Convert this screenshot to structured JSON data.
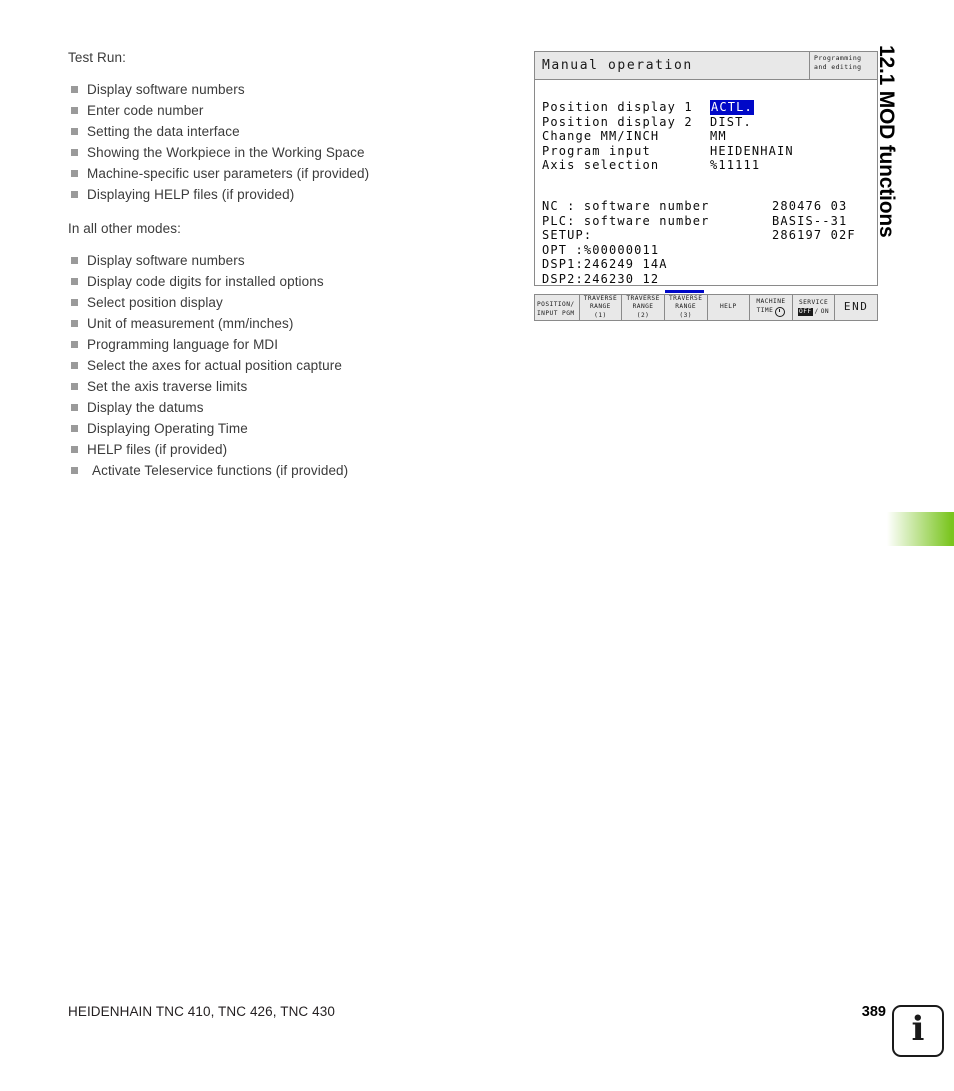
{
  "left_column": {
    "heading_1": "Test Run:",
    "list_1": [
      "Display software numbers",
      "Enter code number",
      "Setting the data interface",
      "Showing the Workpiece in the Working Space",
      "Machine-specific user parameters (if provided)",
      "Displaying HELP files (if provided)"
    ],
    "heading_2": "In all other modes:",
    "list_2": [
      "Display software numbers",
      "Display code digits for installed options",
      "Select position display",
      "Unit of measurement (mm/inches)",
      "Programming language for MDI",
      "Select the axes for actual position capture",
      "Set the axis traverse limits",
      "Display the datums",
      "Displaying Operating Time",
      "HELP files (if provided)",
      "Activate Teleservice functions (if provided)"
    ]
  },
  "tnc_screen": {
    "mode_title": "Manual operation",
    "submode_line1": "Programming",
    "submode_line2": "and editing",
    "mod_rows": [
      {
        "label": "Position display 1",
        "value": "ACTL.",
        "highlighted": true
      },
      {
        "label": "Position display 2",
        "value": "DIST.",
        "highlighted": false
      },
      {
        "label": "Change MM/INCH",
        "value": "MM",
        "highlighted": false
      },
      {
        "label": "Program input",
        "value": "HEIDENHAIN",
        "highlighted": false
      },
      {
        "label": "Axis selection",
        "value": "%11111",
        "highlighted": false
      }
    ],
    "software_rows": [
      {
        "label": "NC : software number",
        "value": "280476 03"
      },
      {
        "label": "PLC: software number",
        "value": "BASIS--31"
      },
      {
        "label": "SETUP:",
        "value": "286197 02F"
      },
      {
        "label": "OPT :%00000011",
        "value": ""
      },
      {
        "label": "DSP1:246249 14A",
        "value": ""
      },
      {
        "label": "DSP2:246230 12",
        "value": ""
      }
    ],
    "highlight_color": "#0008c8",
    "softkeys": [
      {
        "name": "position-input-pgm",
        "lines": [
          "POSITION/",
          "INPUT PGM"
        ],
        "style": "split",
        "active": false
      },
      {
        "name": "traverse-range-1",
        "lines": [
          "TRAVERSE",
          "RANGE",
          "(1)"
        ],
        "style": "stack",
        "active": false
      },
      {
        "name": "traverse-range-2",
        "lines": [
          "TRAVERSE",
          "RANGE",
          "(2)"
        ],
        "style": "stack",
        "active": false
      },
      {
        "name": "traverse-range-3",
        "lines": [
          "TRAVERSE",
          "RANGE",
          "(3)"
        ],
        "style": "stack",
        "active": true
      },
      {
        "name": "help",
        "lines": [
          "HELP"
        ],
        "style": "stack",
        "active": false
      },
      {
        "name": "machine-time",
        "lines": [
          "MACHINE",
          "TIME"
        ],
        "style": "clock",
        "active": false
      },
      {
        "name": "service-off-on",
        "lines": [
          "SERVICE"
        ],
        "style": "toggle",
        "off_label": "OFF",
        "sep_label": "/",
        "on_label": "ON",
        "active": false
      },
      {
        "name": "end",
        "lines": [
          "END"
        ],
        "style": "big",
        "active": false
      }
    ]
  },
  "side_title": "12.1 MOD functions",
  "footer": {
    "text": "HEIDENHAIN TNC 410, TNC 426, TNC 430",
    "page_number": "389",
    "info_glyph": "i"
  }
}
